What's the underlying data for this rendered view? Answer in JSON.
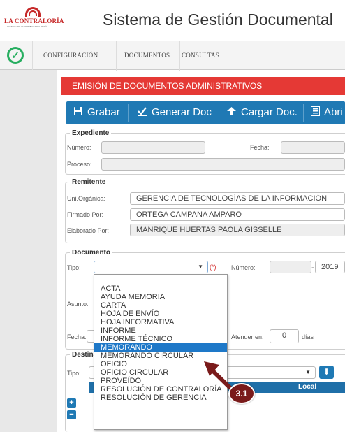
{
  "header": {
    "logo_name": "LA CONTRALORÍA",
    "logo_subtitle": "GENERAL DE LA REPÚBLICA DEL PERÚ",
    "app_title": "Sistema de Gestión Documental"
  },
  "nav": {
    "items": [
      "CONFIGURACIÓN",
      "DOCUMENTOS",
      "CONSULTAS"
    ]
  },
  "panel": {
    "title": "EMISIÓN DE DOCUMENTOS ADMINISTRATIVOS"
  },
  "toolbar": {
    "grabar": "Grabar",
    "generar": "Generar Doc",
    "cargar": "Cargar Doc.",
    "abrir": "Abri"
  },
  "expediente": {
    "legend": "Expediente",
    "numero_label": "Número:",
    "numero_value": "",
    "fecha_label": "Fecha:",
    "fecha_value": "",
    "proceso_label": "Proceso:",
    "proceso_value": ""
  },
  "remitente": {
    "legend": "Remitente",
    "uni_label": "Uni.Orgánica:",
    "uni_value": "GERENCIA DE TECNOLOGÍAS DE LA INFORMACIÓN",
    "firmado_label": "Firmado Por:",
    "firmado_value": "ORTEGA CAMPANA AMPARO",
    "elaborado_label": "Elaborado Por:",
    "elaborado_value": "MANRIQUE HUERTAS PAOLA GISSELLE"
  },
  "documento": {
    "legend": "Documento",
    "tipo_label": "Tipo:",
    "required_mark": "(*)",
    "numero_label": "Número:",
    "numero_value": "",
    "year_value": "2019",
    "year_dash": "-",
    "asunto_label": "Asunto:",
    "fecha_label": "Fecha:",
    "atender_label": "Atender en:",
    "atender_value": "0",
    "dias_label": "días"
  },
  "tipo_options": [
    "ACTA",
    "AYUDA MEMORIA",
    "CARTA",
    "HOJA DE ENVÍO",
    "HOJA INFORMATIVA",
    "INFORME",
    "INFORME TÉCNICO",
    "MEMORANDO",
    "MEMORANDO CIRCULAR",
    "OFICIO",
    "OFICIO CIRCULAR",
    "PROVEÍDO",
    "RESOLUCIÓN DE CONTRALORÍA",
    "RESOLUCIÓN DE GERENCIA"
  ],
  "tipo_highlighted": "MEMORANDO",
  "destinatario": {
    "legend": "Destina",
    "tipo_label": "Tipo:",
    "tipo_value": "C",
    "local_header": "Local"
  },
  "annotation": {
    "step": "3.1",
    "color": "#7a1b1b"
  },
  "colors": {
    "accent_red": "#e53935",
    "toolbar_blue": "#1f79b4",
    "selection_blue": "#1e78c8",
    "success_green": "#27ae60"
  }
}
